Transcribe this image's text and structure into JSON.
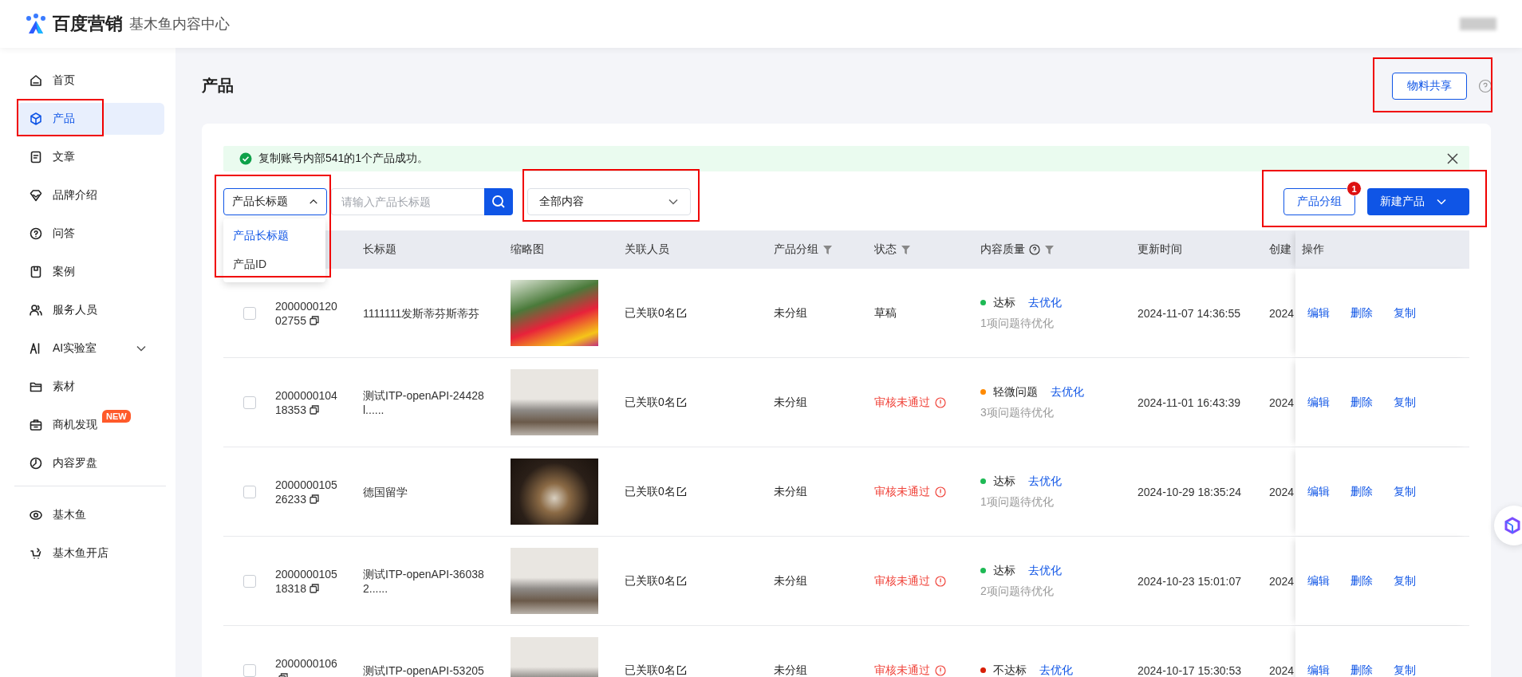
{
  "header": {
    "logo_text": "百度营销",
    "product_name": "基木鱼内容中心"
  },
  "sidebar": {
    "items": [
      {
        "label": "首页",
        "selected": false
      },
      {
        "label": "产品",
        "selected": true
      },
      {
        "label": "文章",
        "selected": false
      },
      {
        "label": "品牌介绍",
        "selected": false
      },
      {
        "label": "问答",
        "selected": false
      },
      {
        "label": "案例",
        "selected": false
      },
      {
        "label": "服务人员",
        "selected": false
      },
      {
        "label": "AI实验室",
        "selected": false,
        "expanded": false
      },
      {
        "label": "素材",
        "selected": false
      },
      {
        "label": "商机发现",
        "selected": false,
        "badge": "NEW"
      },
      {
        "label": "内容罗盘",
        "selected": false
      }
    ],
    "bottom_items": [
      {
        "label": "基木鱼",
        "selected": false
      },
      {
        "label": "基木鱼开店",
        "selected": false
      }
    ]
  },
  "page": {
    "title": "产品",
    "share_button": "物料共享"
  },
  "alert": {
    "text": "复制账号内部541的1个产品成功。"
  },
  "toolbar": {
    "field_select": {
      "value": "产品长标题",
      "expanded": true,
      "options": [
        {
          "label": "产品长标题",
          "selected": true
        },
        {
          "label": "产品ID",
          "selected": false
        }
      ]
    },
    "search": {
      "placeholder": "请输入产品长标题"
    },
    "content_filter": {
      "value": "全部内容"
    },
    "group_button": {
      "label": "产品分组",
      "badge": "1"
    },
    "create_button": {
      "label": "新建产品"
    }
  },
  "table": {
    "columns": [
      {
        "label": "长标题",
        "filterable": false,
        "help": false
      },
      {
        "label": "缩略图",
        "filterable": false,
        "help": false
      },
      {
        "label": "关联人员",
        "filterable": false,
        "help": false
      },
      {
        "label": "产品分组",
        "filterable": true,
        "help": false
      },
      {
        "label": "状态",
        "filterable": true,
        "help": false
      },
      {
        "label": "内容质量",
        "filterable": true,
        "help": true
      },
      {
        "label": "更新时间",
        "filterable": false,
        "help": false
      },
      {
        "label": "创建"
      },
      {
        "label": "操作",
        "filterable": false,
        "help": false
      }
    ],
    "rows": [
      {
        "checked": false,
        "id": "200000012002755",
        "title": "1111111发斯蒂芬斯蒂芬",
        "members": "已关联0名",
        "group": "未分组",
        "status": {
          "text": "草稿",
          "kind": "draft"
        },
        "quality": {
          "label": "达标",
          "color": "#1db954",
          "action": "去优化",
          "note": "1项问题待优化"
        },
        "updated": "2024-11-07 14:36:55",
        "created": "2024",
        "actions": [
          "编辑",
          "删除",
          "复制"
        ]
      },
      {
        "checked": false,
        "id": "200000010418353",
        "title": "测试ITP-openAPI-24428 l......",
        "members": "已关联0名",
        "group": "未分组",
        "status": {
          "text": "审核未通过",
          "kind": "rejected"
        },
        "quality": {
          "label": "轻微问题",
          "color": "#ff8a00",
          "action": "去优化",
          "note": "3项问题待优化"
        },
        "updated": "2024-11-01 16:43:39",
        "created": "2024",
        "actions": [
          "编辑",
          "删除",
          "复制"
        ]
      },
      {
        "checked": false,
        "id": "200000010526233",
        "title": "德国留学",
        "members": "已关联0名",
        "group": "未分组",
        "status": {
          "text": "审核未通过",
          "kind": "rejected"
        },
        "quality": {
          "label": "达标",
          "color": "#1db954",
          "action": "去优化",
          "note": "1项问题待优化"
        },
        "updated": "2024-10-29 18:35:24",
        "created": "2024",
        "actions": [
          "编辑",
          "删除",
          "复制"
        ]
      },
      {
        "checked": false,
        "id": "200000010518318",
        "title": "测试ITP-openAPI-36038 2......",
        "members": "已关联0名",
        "group": "未分组",
        "status": {
          "text": "审核未通过",
          "kind": "rejected"
        },
        "quality": {
          "label": "达标",
          "color": "#1db954",
          "action": "去优化",
          "note": "2项问题待优化"
        },
        "updated": "2024-10-23 15:01:07",
        "created": "2024",
        "actions": [
          "编辑",
          "删除",
          "复制"
        ]
      },
      {
        "checked": false,
        "id": "2000000106",
        "title": "测试ITP-openAPI-53205",
        "members": "已关联0名",
        "group": "未分组",
        "status": {
          "text": "审核未通过",
          "kind": "rejected"
        },
        "quality": {
          "label": "不达标",
          "color": "#d81e06",
          "action": "去优化"
        },
        "updated": "2024-10-17 15:30:53",
        "created": "2024",
        "actions": [
          "编辑",
          "删除",
          "复制"
        ]
      }
    ]
  }
}
